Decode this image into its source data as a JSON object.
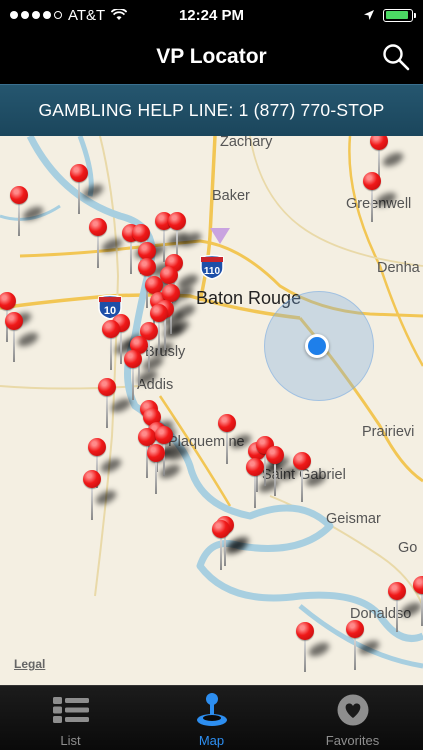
{
  "status": {
    "carrier": "AT&T",
    "time": "12:24 PM",
    "battery_level": 0.9,
    "signal_bars": 4
  },
  "nav": {
    "title": "VP Locator"
  },
  "helpline": {
    "text": "GAMBLING HELP LINE: 1 (877) 770-STOP"
  },
  "map": {
    "cities": {
      "zachary": "Zachary",
      "baker": "Baker",
      "greenwell": "Greenwell",
      "denham": "Denha",
      "baton_rouge": "Baton Rouge",
      "brusly": "Brusly",
      "addis": "Addis",
      "plaquemine": "Plaquemine",
      "prairieville": "Prairievi",
      "saint_gabriel": "Saint Gabriel",
      "geismar": "Geismar",
      "gonzales": "Go",
      "donaldsonville": "Donaldso"
    },
    "highways": {
      "i110": "110",
      "i10": "10"
    },
    "legal": "Legal"
  },
  "tabs": [
    {
      "label": "List",
      "icon": "list-icon"
    },
    {
      "label": "Map",
      "icon": "joystick-icon"
    },
    {
      "label": "Favorites",
      "icon": "heart-icon"
    }
  ],
  "colors": {
    "pin": "#f01919",
    "user_location": "#1e7fea",
    "helpline_bg": "#1f4d65",
    "active_tab": "#2d8ef0"
  }
}
